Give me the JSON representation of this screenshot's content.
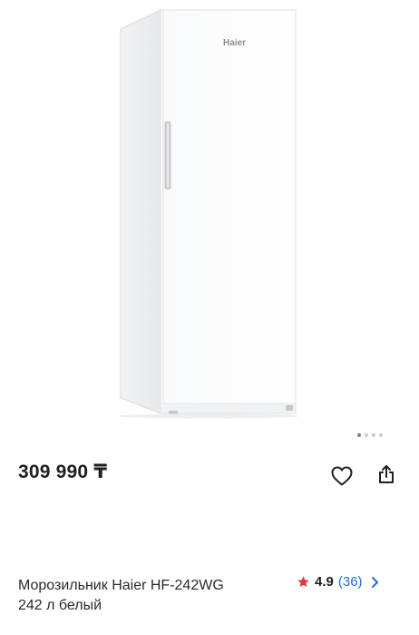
{
  "product": {
    "brand_logo_text": "Haier",
    "price": "309 990 ₸",
    "title_line1": "Морозильник Haier HF-242WG",
    "title_line2": "242 л белый"
  },
  "gallery": {
    "dots_total": 4,
    "active_index": 0
  },
  "rating": {
    "score": "4.9",
    "reviews": "(36)",
    "star_color": "#e03b3b"
  },
  "icons": {
    "favorite": "heart-outline-icon",
    "share": "share-icon",
    "rating": "star-icon",
    "more": "chevron-right-icon"
  },
  "colors": {
    "accent": "#1f6fd6",
    "text": "#1f1f1f"
  }
}
